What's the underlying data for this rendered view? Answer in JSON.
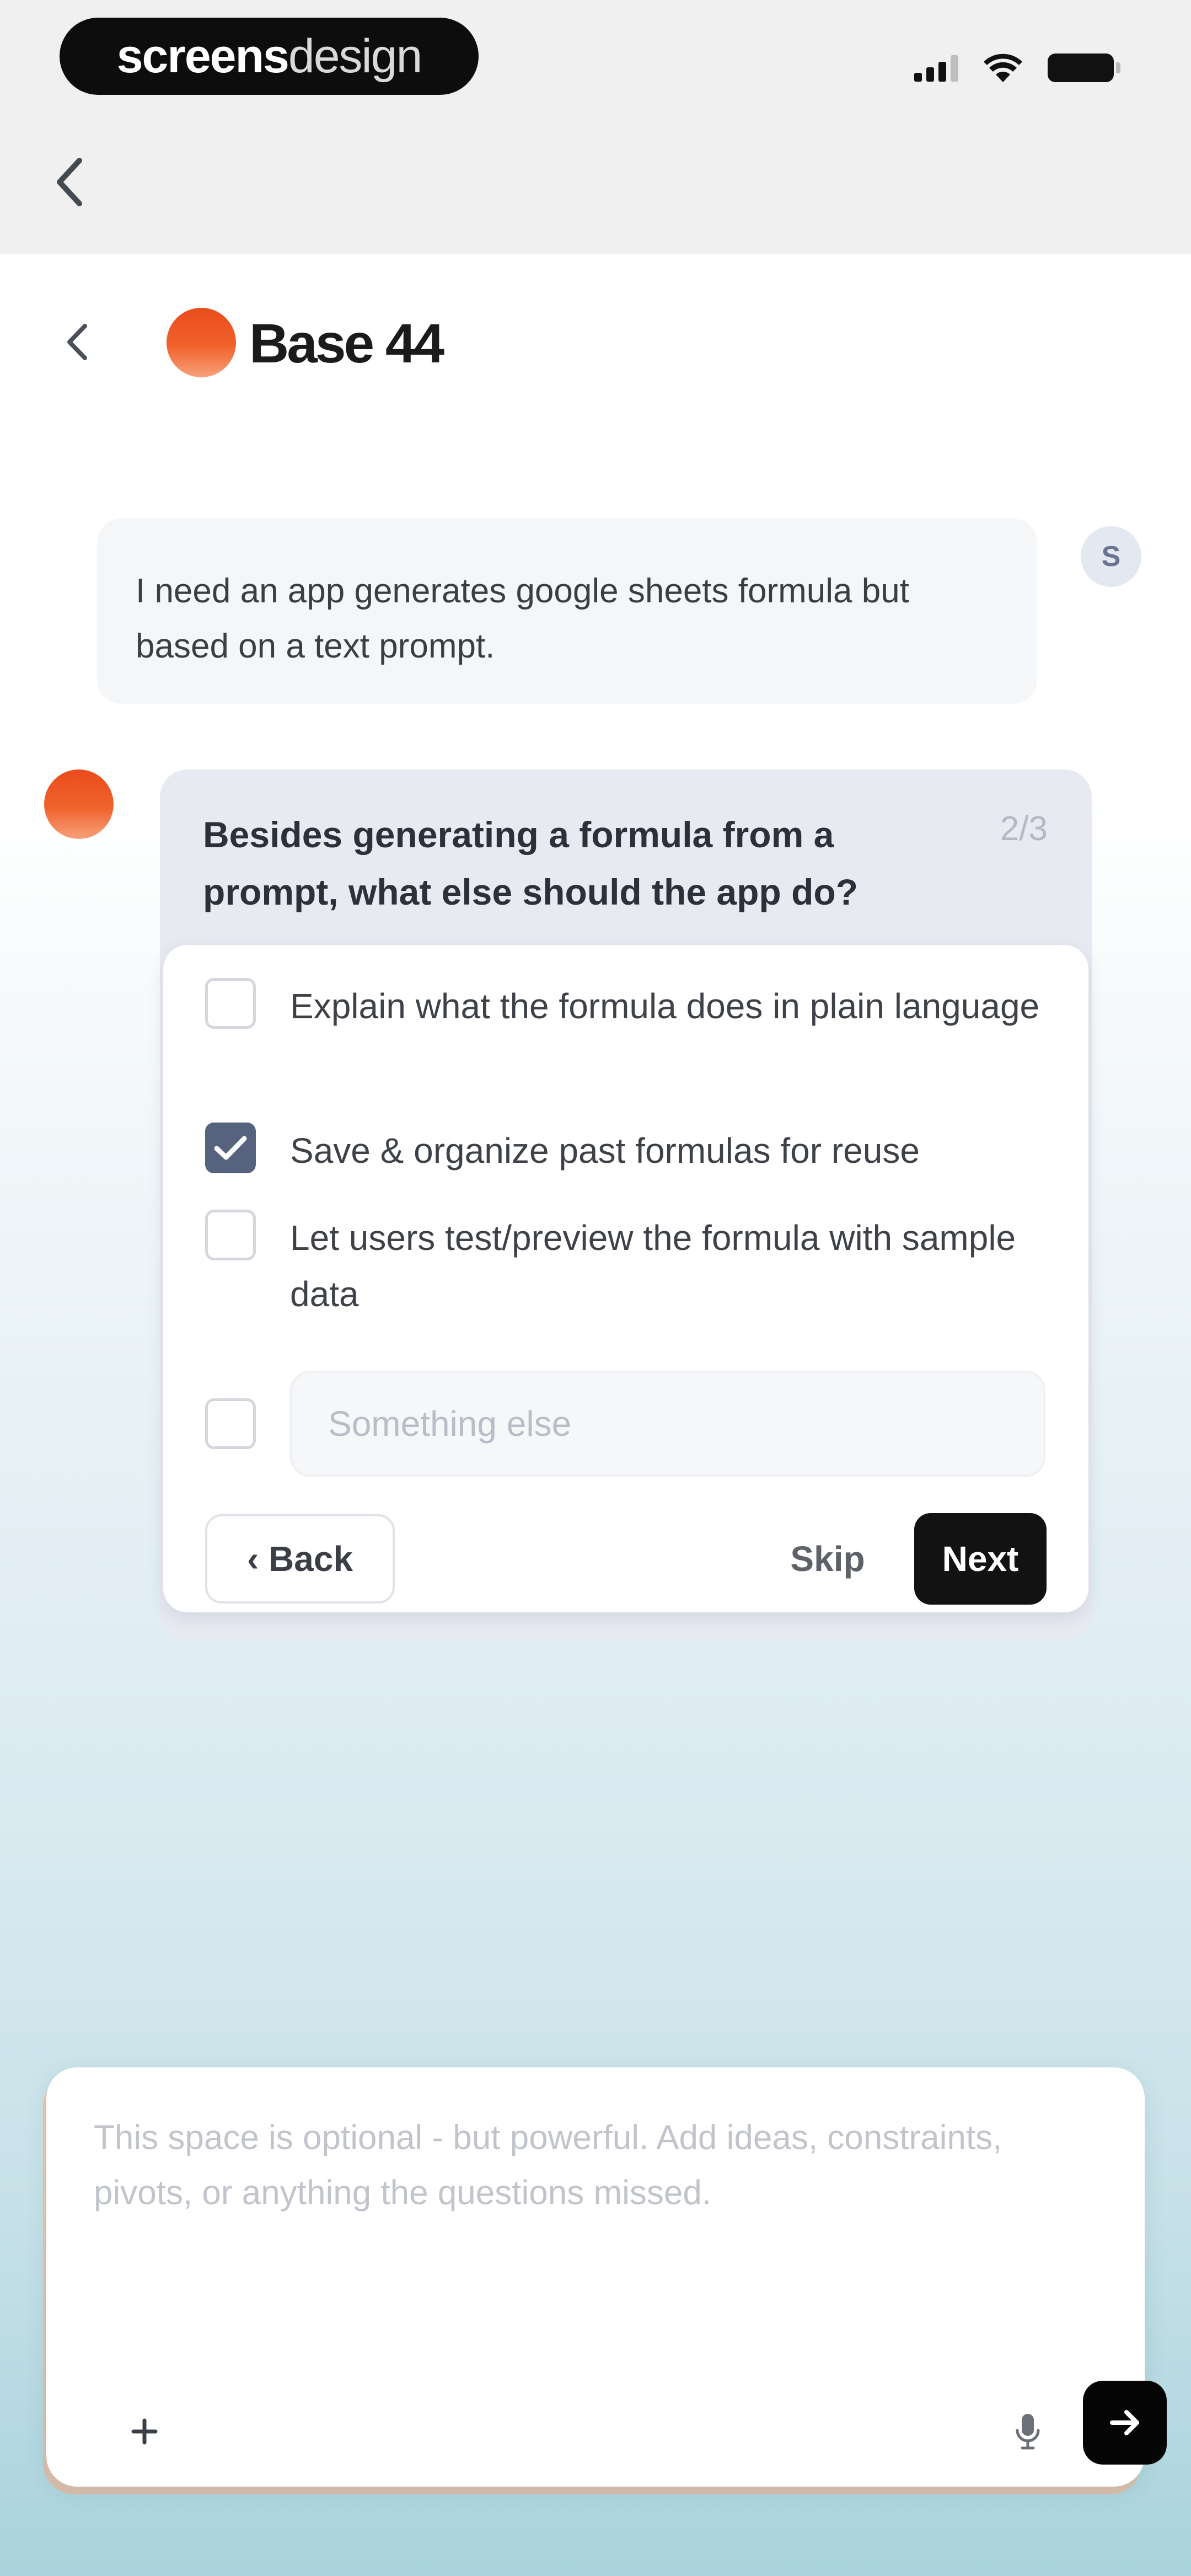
{
  "status_bar": {
    "brand_bold": "screens",
    "brand_light": "design"
  },
  "header": {
    "title": "Base 44"
  },
  "chat": {
    "user_message": "I need an app generates google sheets formula but based on a text prompt.",
    "user_avatar_initial": "S",
    "question": {
      "text": "Besides generating a formula from a prompt, what else should the app do?",
      "counter": "2/3",
      "options": [
        {
          "label": "Explain what the formula does in plain language",
          "checked": false
        },
        {
          "label": "Save & organize past formulas for reuse",
          "checked": true
        },
        {
          "label": "Let users test/preview the formula with sample data",
          "checked": false
        }
      ],
      "other_placeholder": "Something else",
      "back_label": "‹ Back",
      "skip_label": "Skip",
      "next_label": "Next"
    }
  },
  "composer": {
    "placeholder": "This space is optional - but powerful. Add ideas, constraints, pivots, or anything the questions missed."
  },
  "colors": {
    "brand_orange": "#ea4c1c",
    "checked_box": "#56627e",
    "question_card": "#e8eaf2",
    "send_button": "#050505"
  },
  "icons": {
    "browser_back": "chevron-left-icon",
    "app_back": "chevron-left-icon",
    "check": "check-icon",
    "plus": "plus-icon",
    "mic": "microphone-icon",
    "send": "arrow-right-icon"
  }
}
